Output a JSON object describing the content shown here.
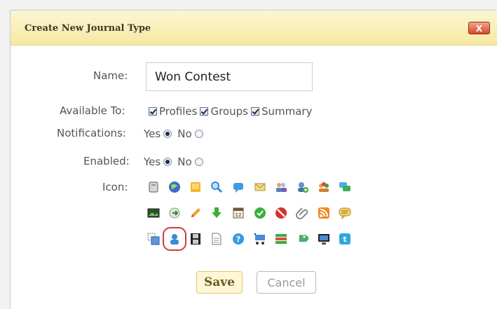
{
  "dialog": {
    "title": "Create New Journal Type",
    "close_label": "X"
  },
  "form": {
    "name_label": "Name:",
    "name_value": "Won Contest",
    "available_label": "Available To:",
    "available": [
      {
        "label": "Profiles",
        "checked": true
      },
      {
        "label": "Groups",
        "checked": true
      },
      {
        "label": "Summary",
        "checked": true
      }
    ],
    "notifications_label": "Notifications:",
    "notifications_yes": "Yes",
    "notifications_no": "No",
    "notifications_selected": "Yes",
    "enabled_label": "Enabled:",
    "enabled_yes": "Yes",
    "enabled_no": "No",
    "enabled_selected": "Yes",
    "icon_label": "Icon:"
  },
  "icons": [
    [
      "scroll-icon",
      "globe-icon",
      "note-icon",
      "magnifier-icon",
      "speech-bubble-icon",
      "envelope-icon",
      "users-icon",
      "user-add-icon",
      "group-icon",
      "chat-icon"
    ],
    [
      "picture-icon",
      "arrow-right-circle-icon",
      "pencil-icon",
      "arrow-down-icon",
      "calendar-icon",
      "check-circle-icon",
      "stop-icon",
      "attachment-icon",
      "rss-icon",
      "comment-icon"
    ],
    [
      "layers-icon",
      "user-icon",
      "film-icon",
      "document-icon",
      "help-icon",
      "cart-icon",
      "list-icon",
      "tag-icon",
      "monitor-icon",
      "twitter-icon"
    ]
  ],
  "selected_icon": "user-icon",
  "buttons": {
    "save": "Save",
    "cancel": "Cancel"
  }
}
